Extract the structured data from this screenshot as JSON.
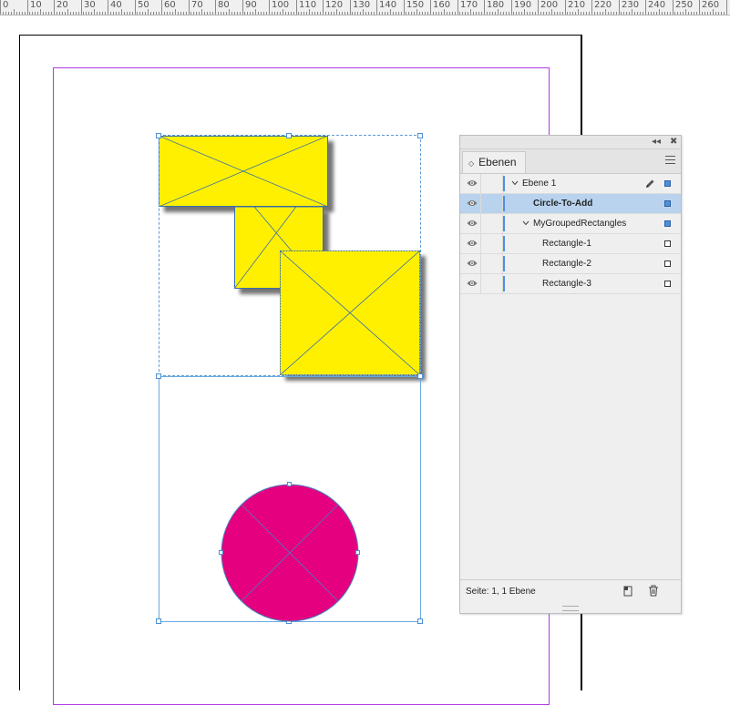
{
  "ruler": {
    "labels": [
      "0",
      "10",
      "20",
      "30",
      "40",
      "50",
      "60",
      "70",
      "80",
      "90",
      "100",
      "110",
      "120",
      "130",
      "140",
      "150",
      "160",
      "170",
      "180",
      "190",
      "200",
      "210",
      "220",
      "230",
      "240",
      "250",
      "260"
    ]
  },
  "panel": {
    "tab_label": "Ebenen",
    "collapse_label": "◂◂",
    "close_label": "✖",
    "rows": [
      {
        "label": "Ebene 1",
        "twisty": "open",
        "selected": false,
        "pen": true,
        "square": "filled",
        "bold": false
      },
      {
        "label": "Circle-To-Add",
        "twisty": "none",
        "selected": true,
        "pen": false,
        "square": "filled",
        "bold": true
      },
      {
        "label": "MyGroupedRectangles",
        "twisty": "open",
        "selected": false,
        "pen": false,
        "square": "filled",
        "bold": false
      },
      {
        "label": "Rectangle-1",
        "twisty": "none",
        "selected": false,
        "pen": false,
        "square": "empty",
        "bold": false
      },
      {
        "label": "Rectangle-2",
        "twisty": "none",
        "selected": false,
        "pen": false,
        "square": "empty",
        "bold": false
      },
      {
        "label": "Rectangle-3",
        "twisty": "none",
        "selected": false,
        "pen": false,
        "square": "empty",
        "bold": false
      }
    ],
    "footer_text": "Seite: 1, 1 Ebene"
  },
  "colors": {
    "rect_fill": "#fff000",
    "circle_fill": "#e4007f",
    "layer_color": "#4a90e2",
    "margin_guide": "#b03adf",
    "selection": "#4a90d6"
  }
}
